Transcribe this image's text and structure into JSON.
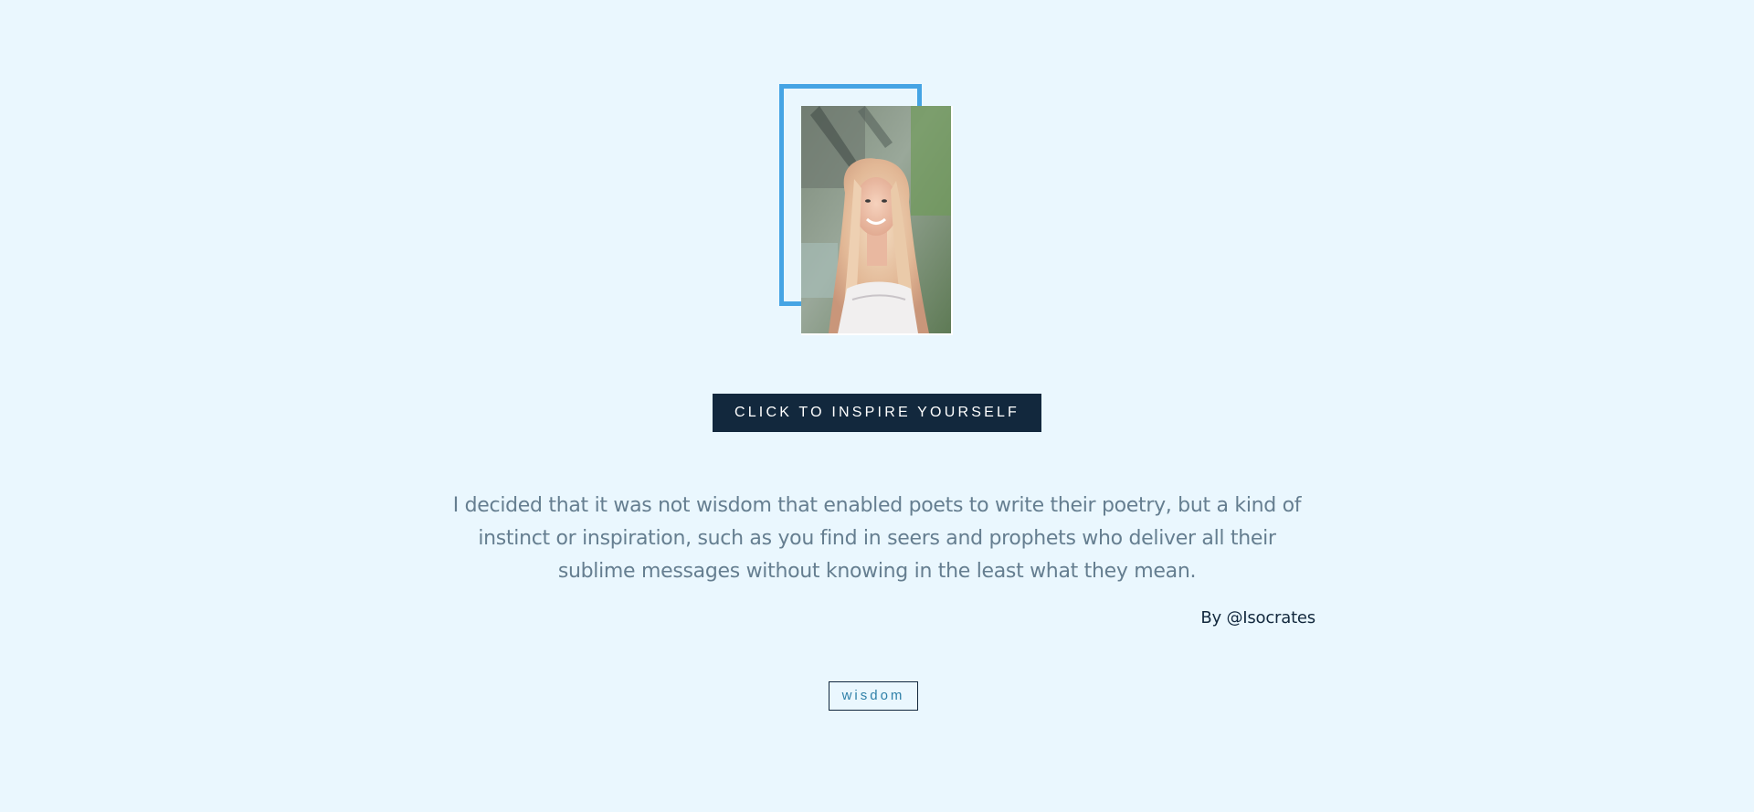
{
  "hero": {
    "photo_alt": "Portrait of a smiling woman with long blonde hair"
  },
  "actions": {
    "inspire_label": "CLICK TO INSPIRE YOURSELF"
  },
  "quote": {
    "text": "I decided that it was not wisdom that enabled poets to write their poetry, but a kind of instinct or inspiration, such as you find in seers and prophets who deliver all their sublime messages without knowing in the least what they mean.",
    "author": "By @Isocrates"
  },
  "tags": [
    {
      "label": "wisdom"
    }
  ],
  "colors": {
    "background": "#eaf7fe",
    "frame_accent": "#45a4e4",
    "button_bg": "#12283d",
    "quote_text": "#657e90",
    "tag_text": "#2f80a8"
  }
}
